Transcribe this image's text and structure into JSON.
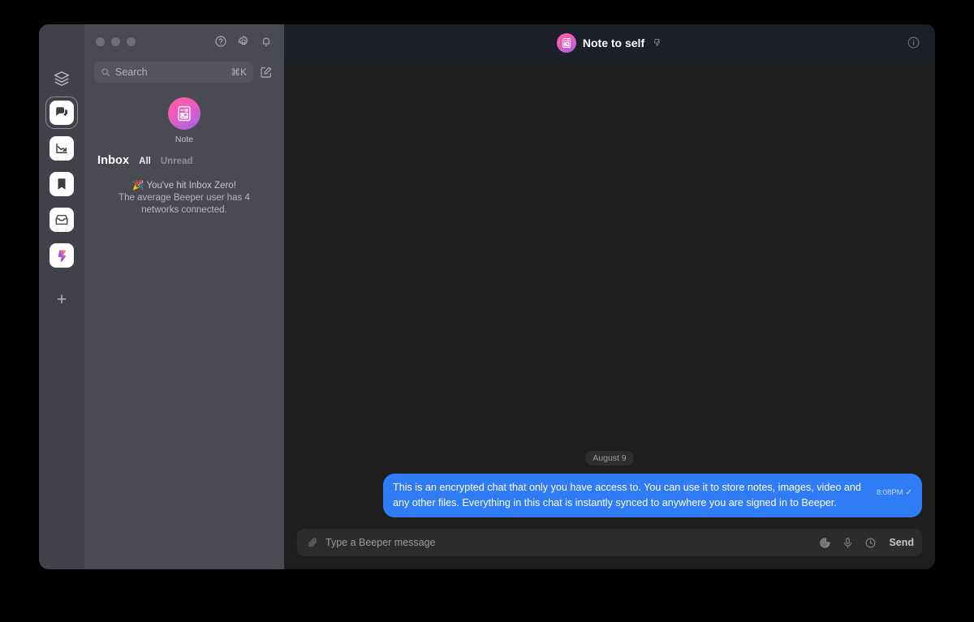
{
  "window": {
    "traffic_lights": [
      "close",
      "minimize",
      "zoom"
    ],
    "titlebar_icons": [
      "help-circle-icon",
      "gear-icon",
      "bell-icon"
    ]
  },
  "rail": {
    "top_icon": "layers-icon",
    "apps": [
      {
        "name": "chats",
        "icon": "chat-bubbles-icon",
        "selected": true
      },
      {
        "name": "trends",
        "icon": "chart-down-icon",
        "selected": false
      },
      {
        "name": "saved",
        "icon": "bookmark-icon",
        "selected": false
      },
      {
        "name": "archive",
        "icon": "inbox-tray-icon",
        "selected": false
      },
      {
        "name": "beeper",
        "icon": "beeper-logo-icon",
        "selected": false
      }
    ],
    "add_label": "+"
  },
  "search": {
    "placeholder": "Search",
    "shortcut": "⌘K",
    "icon": "search-icon",
    "compose_icon": "compose-icon"
  },
  "note": {
    "avatar_icon": "note-avatar-icon",
    "label": "Note"
  },
  "inbox": {
    "title": "Inbox",
    "tabs": [
      {
        "label": "All",
        "active": true
      },
      {
        "label": "Unread",
        "active": false
      }
    ],
    "empty_emoji": "🎉",
    "empty_line1": "You've hit Inbox Zero!",
    "empty_line2": "The average Beeper user has 4 networks connected."
  },
  "chat": {
    "title": "Note to self",
    "avatar_icon": "note-avatar-icon",
    "network_badge_icon": "beeper-network-icon",
    "info_icon": "info-circle-icon",
    "date_separator": "August 9",
    "messages": [
      {
        "text": "This is an encrypted chat that only you have access to. You can use it to store notes, images, video and any other files. Everything in this chat is instantly synced to anywhere you are signed in to Beeper.",
        "time": "8:08PM",
        "status_tick": "✓",
        "outgoing": true
      }
    ]
  },
  "composer": {
    "attach_icon": "paperclip-icon",
    "placeholder": "Type a Beeper message",
    "actions": [
      {
        "name": "sticker-icon"
      },
      {
        "name": "microphone-icon"
      },
      {
        "name": "schedule-clock-icon"
      }
    ],
    "send_label": "Send"
  },
  "colors": {
    "desktop_bg": "#000000",
    "rail_bg": "#414149",
    "sidebar_bg": "#4a4a52",
    "chat_bg": "#1e1e1e",
    "chat_header_bg": "#1c2029",
    "bubble_blue": "#2f7cf6",
    "avatar_gradient_from": "#ff5fa2",
    "avatar_gradient_to": "#a061e0"
  }
}
